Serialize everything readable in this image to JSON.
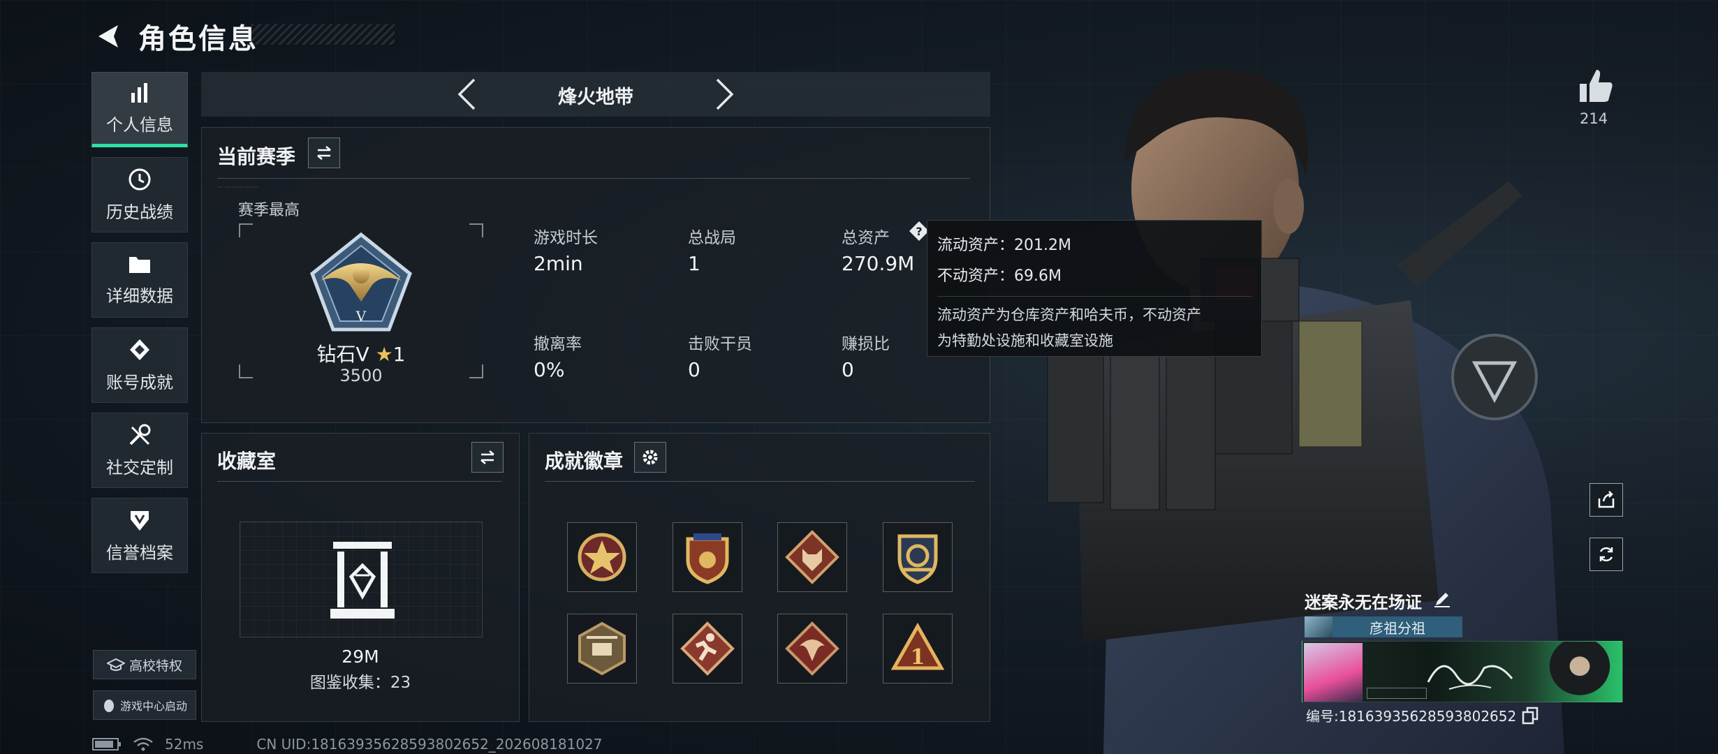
{
  "header": {
    "title": "角色信息"
  },
  "nav": {
    "items": [
      {
        "label": "个人信息",
        "icon": "bar-chart-icon",
        "active": true
      },
      {
        "label": "历史战绩",
        "icon": "clock-icon",
        "active": false
      },
      {
        "label": "详细数据",
        "icon": "folder-icon",
        "active": false
      },
      {
        "label": "账号成就",
        "icon": "diamond-achievement-icon",
        "active": false
      },
      {
        "label": "社交定制",
        "icon": "tools-icon",
        "active": false
      },
      {
        "label": "信誉档案",
        "icon": "reputation-shield-icon",
        "active": false
      }
    ],
    "campus_label": "高校特权",
    "game_center_label": "游戏中心启动"
  },
  "status": {
    "ping": "52ms",
    "uid": "CN UID:18163935628593802652_202608181027"
  },
  "mode": {
    "title": "烽火地带"
  },
  "season": {
    "title": "当前赛季",
    "best_label": "赛季最高",
    "rank": "钻石V",
    "rank_stars": "1",
    "rank_points": "3500",
    "stats": [
      {
        "label": "游戏时长",
        "value": "2min"
      },
      {
        "label": "总战局",
        "value": "1"
      },
      {
        "label": "总资产",
        "value": "270.9M"
      },
      {
        "label": "撤离率",
        "value": "0%"
      },
      {
        "label": "击败干员",
        "value": "0"
      },
      {
        "label": "赚损比",
        "value": "0"
      }
    ]
  },
  "tooltip": {
    "liquid": "流动资产：201.2M",
    "fixed": "不动资产：69.6M",
    "desc_line1": "流动资产为仓库资产和哈夫币，不动资产",
    "desc_line2": "为特勤处设施和收藏室设施"
  },
  "collection": {
    "title": "收藏室",
    "value": "29M",
    "count": "图鉴收集：23"
  },
  "achievements": {
    "title": "成就徽章",
    "badges": [
      "star-badge-icon",
      "shield-badge-icon",
      "wolf-badge-icon",
      "crest-badge-icon",
      "helicopter-badge-icon",
      "runner-badge-icon",
      "dragon-badge-icon",
      "triangle-one-badge-icon"
    ]
  },
  "profile": {
    "likes": "214",
    "name": "迷案永无在场证",
    "group": "彦祖分祖",
    "id_line": "编号:18163935628593802652"
  }
}
